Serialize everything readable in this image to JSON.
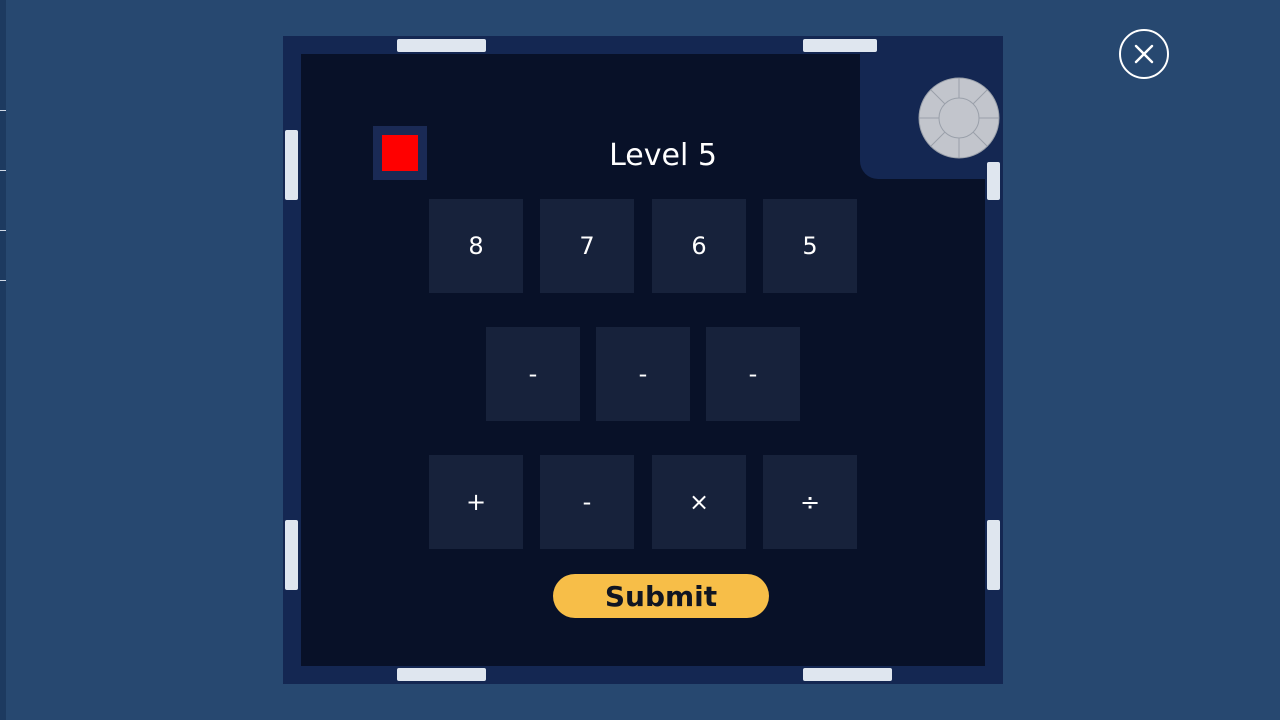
{
  "level": {
    "title": "Level 5"
  },
  "status": {
    "color": "#ff0000",
    "icon": "red-square-icon"
  },
  "numbers": [
    "8",
    "7",
    "6",
    "5"
  ],
  "answer_slots": [
    "-",
    "-",
    "-"
  ],
  "operators": [
    "+",
    "-",
    "×",
    "÷"
  ],
  "submit": {
    "label": "Submit",
    "color": "#f7be48"
  },
  "close": {
    "icon": "close-icon"
  },
  "dial": {
    "icon": "dial-icon"
  }
}
